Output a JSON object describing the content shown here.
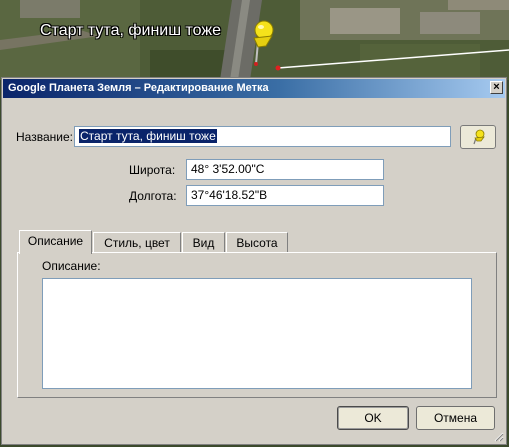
{
  "map": {
    "placemark_label": "Старт тута, финиш тоже"
  },
  "dialog": {
    "title": "Google Планета Земля – Редактирование Метка",
    "close_glyph": "×",
    "name_label": "Название:",
    "name_value": "Старт тута, финиш тоже",
    "latitude_label": "Широта:",
    "latitude_value": "48° 3'52.00\"С",
    "longitude_label": "Долгота:",
    "longitude_value": "37°46'18.52\"В",
    "tabs": [
      {
        "label": "Описание",
        "active": true
      },
      {
        "label": "Стиль, цвет",
        "active": false
      },
      {
        "label": "Вид",
        "active": false
      },
      {
        "label": "Высота",
        "active": false
      }
    ],
    "description_label": "Описание:",
    "description_value": "",
    "ok_label": "OK",
    "cancel_label": "Отмена",
    "pin_icon": "pushpin-icon",
    "accent_pin_color": "#f5e21b"
  }
}
